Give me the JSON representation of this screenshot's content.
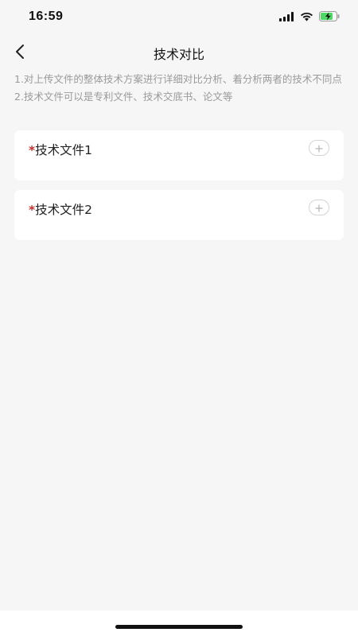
{
  "status_bar": {
    "time": "16:59",
    "icons": [
      "signal-icon",
      "wifi-icon",
      "battery-charging-icon"
    ]
  },
  "nav": {
    "back_icon": "chevron-left-icon",
    "title": "技术对比"
  },
  "description": {
    "line1": "1.对上传文件的整体技术方案进行详细对比分析、着分析两者的技术不同点",
    "line2": "2.技术文件可以是专利文件、技术交底书、论文等"
  },
  "files": [
    {
      "required_mark": "*",
      "label": "技术文件1",
      "add_icon": "plus-icon"
    },
    {
      "required_mark": "*",
      "label": "技术文件2",
      "add_icon": "plus-icon"
    }
  ],
  "colors": {
    "background": "#f6f6f6",
    "card": "#ffffff",
    "required": "#c0312b",
    "hint_text": "#9a9a9a",
    "battery_fill": "#4cd964"
  }
}
